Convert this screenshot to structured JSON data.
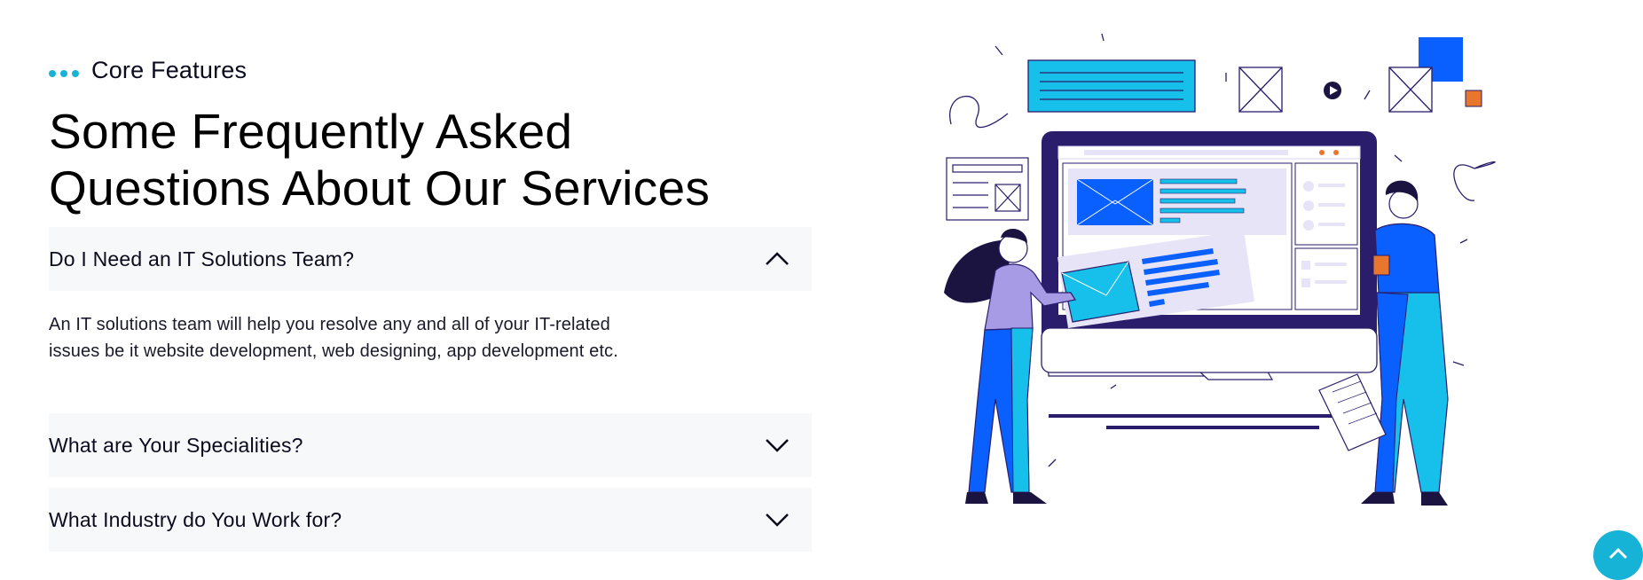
{
  "colors": {
    "accent": "#16b3d6",
    "panel": "#f7f8f9",
    "navy": "#2a1d6b",
    "blue": "#0a5fff"
  },
  "section": {
    "eyebrow": "Core Features",
    "heading_lines": [
      "Some Frequently Asked",
      "Questions About Our Services"
    ]
  },
  "faq": [
    {
      "question": "Do I Need an IT Solutions Team?",
      "expanded": true,
      "icon": "chevron-up-icon",
      "answer_lines": [
        "An IT solutions team will help you resolve any and all of your IT-related",
        "issues be it website development, web designing, app development etc."
      ]
    },
    {
      "question": "What are Your Specialities?",
      "expanded": false,
      "icon": "chevron-down-icon"
    },
    {
      "question": "What Industry do You Work for?",
      "expanded": false,
      "icon": "chevron-down-icon"
    }
  ],
  "scroll_top": {
    "icon": "chevron-up-icon"
  }
}
